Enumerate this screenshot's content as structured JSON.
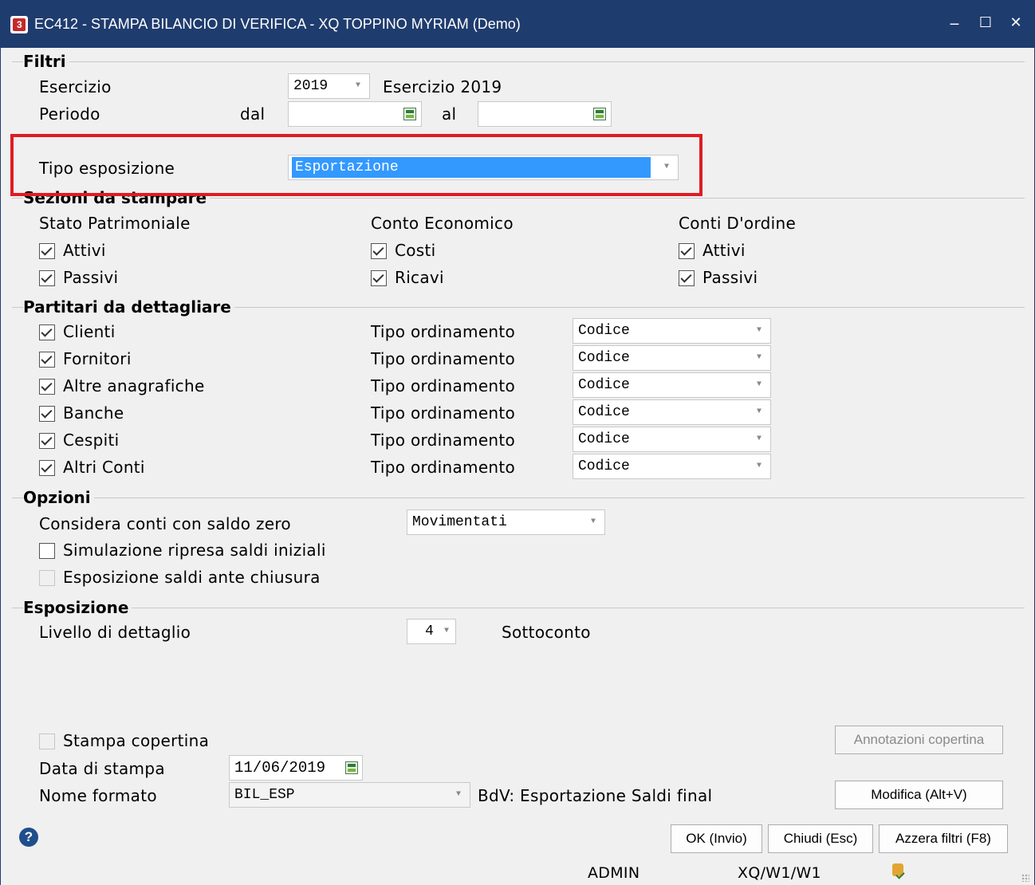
{
  "window": {
    "title": "EC412 - STAMPA BILANCIO DI VERIFICA - XQ TOPPINO MYRIAM  (Demo)",
    "controls": {
      "minimize": "‒",
      "maximize": "☐",
      "close": "✕"
    }
  },
  "filtri": {
    "section": "Filtri",
    "esercizio_label": "Esercizio",
    "esercizio_value": "2019",
    "esercizio_desc": "Esercizio 2019",
    "periodo_label": "Periodo",
    "dal_label": "dal",
    "dal_value": "",
    "al_label": "al",
    "al_value": "",
    "tipo_esposizione_label": "Tipo esposizione",
    "tipo_esposizione_value": "Esportazione"
  },
  "sezioni": {
    "section": "Sezioni da stampare",
    "groups": [
      {
        "label": "Stato Patrimoniale",
        "items": [
          {
            "label": "Attivi",
            "checked": true
          },
          {
            "label": "Passivi",
            "checked": true
          }
        ]
      },
      {
        "label": "Conto Economico",
        "items": [
          {
            "label": "Costi",
            "checked": true
          },
          {
            "label": "Ricavi",
            "checked": true
          }
        ]
      },
      {
        "label": "Conti D'ordine",
        "items": [
          {
            "label": "Attivi",
            "checked": true
          },
          {
            "label": "Passivi",
            "checked": true
          }
        ]
      }
    ]
  },
  "partitari": {
    "section": "Partitari da dettagliare",
    "ordinamento_label": "Tipo ordinamento",
    "rows": [
      {
        "label": "Clienti",
        "checked": true,
        "ordinamento": "Codice"
      },
      {
        "label": "Fornitori",
        "checked": true,
        "ordinamento": "Codice"
      },
      {
        "label": "Altre anagrafiche",
        "checked": true,
        "ordinamento": "Codice"
      },
      {
        "label": "Banche",
        "checked": true,
        "ordinamento": "Codice"
      },
      {
        "label": "Cespiti",
        "checked": true,
        "ordinamento": "Codice"
      },
      {
        "label": "Altri Conti",
        "checked": true,
        "ordinamento": "Codice"
      }
    ]
  },
  "opzioni": {
    "section": "Opzioni",
    "saldo_zero_label": "Considera conti con saldo zero",
    "saldo_zero_value": "Movimentati",
    "simulazione_label": "Simulazione ripresa saldi iniziali",
    "simulazione_checked": false,
    "ante_chiusura_label": "Esposizione saldi ante chiusura",
    "ante_chiusura_checked": false
  },
  "esposizione": {
    "section": "Esposizione",
    "livello_label": "Livello di dettaglio",
    "livello_value": "4",
    "livello_desc": "Sottoconto"
  },
  "stampa": {
    "copertina_label": "Stampa copertina",
    "annotazioni_button": "Annotazioni copertina",
    "data_label": "Data di stampa",
    "data_value": "11/06/2019",
    "formato_label": "Nome formato",
    "formato_value": "BIL_ESP",
    "formato_desc": "BdV: Esportazione Saldi final",
    "modifica_button": "Modifica (Alt+V)"
  },
  "buttons": {
    "ok": "OK (Invio)",
    "chiudi": "Chiudi (Esc)",
    "azzera": "Azzera filtri (F8)"
  },
  "status": {
    "user": "ADMIN",
    "path": "XQ/W1/W1"
  },
  "colors": {
    "titlebar": "#1f3c6e",
    "highlight": "#e01b24",
    "selection": "#3399ff"
  }
}
